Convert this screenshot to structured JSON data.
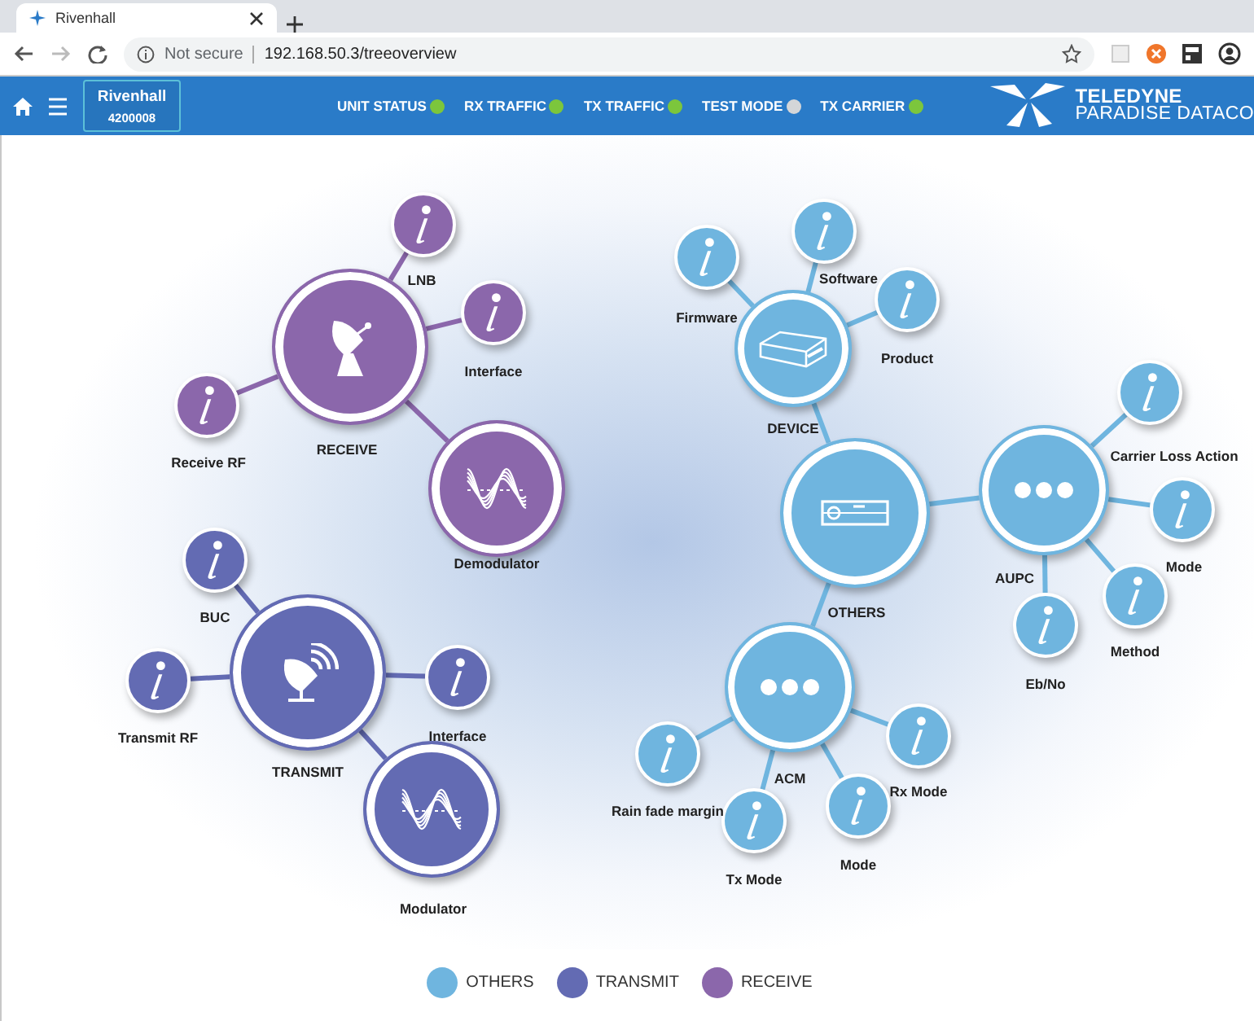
{
  "browser": {
    "tab_title": "Rivenhall",
    "security": "Not secure",
    "url": "192.168.50.3/treeoverview"
  },
  "header": {
    "device_name": "Rivenhall",
    "device_id": "4200008",
    "indicators": [
      {
        "label": "UNIT STATUS",
        "color": "#7cc63c"
      },
      {
        "label": "RX TRAFFIC",
        "color": "#7cc63c"
      },
      {
        "label": "TX TRAFFIC",
        "color": "#7cc63c"
      },
      {
        "label": "TEST MODE",
        "color": "#d4d6d8"
      },
      {
        "label": "TX CARRIER",
        "color": "#7cc63c"
      }
    ],
    "logo_lines": [
      "TELEDYNE",
      "PARADISE DATACO"
    ]
  },
  "diagram": {
    "groups": [
      {
        "label": "RECEIVE",
        "kind": "dish",
        "color": "#8b67ab",
        "children": [
          {
            "label": "LNB",
            "kind": "info"
          },
          {
            "label": "Interface",
            "kind": "info"
          },
          {
            "label": "Receive RF",
            "kind": "info"
          },
          {
            "label": "Demodulator",
            "kind": "wave"
          }
        ]
      },
      {
        "label": "TRANSMIT",
        "kind": "dish-signal",
        "color": "#636bb3",
        "children": [
          {
            "label": "BUC",
            "kind": "info"
          },
          {
            "label": "Transmit RF",
            "kind": "info"
          },
          {
            "label": "Interface",
            "kind": "info"
          },
          {
            "label": "Modulator",
            "kind": "wave"
          }
        ]
      },
      {
        "label": "OTHERS",
        "kind": "rack",
        "color": "#6fb5df",
        "children": [
          {
            "label": "DEVICE",
            "kind": "device",
            "children": [
              {
                "label": "Firmware",
                "kind": "info"
              },
              {
                "label": "Software",
                "kind": "info"
              },
              {
                "label": "Product",
                "kind": "info"
              }
            ]
          },
          {
            "label": "AUPC",
            "kind": "more",
            "children": [
              {
                "label": "Carrier Loss Action",
                "kind": "info"
              },
              {
                "label": "Mode",
                "kind": "info"
              },
              {
                "label": "Method",
                "kind": "info"
              },
              {
                "label": "Eb/No",
                "kind": "info"
              }
            ]
          },
          {
            "label": "ACM",
            "kind": "more",
            "children": [
              {
                "label": "Rain fade margin",
                "kind": "info"
              },
              {
                "label": "Tx Mode",
                "kind": "info"
              },
              {
                "label": "Mode",
                "kind": "info"
              },
              {
                "label": "Rx Mode",
                "kind": "info"
              }
            ]
          }
        ]
      }
    ]
  },
  "legend": [
    {
      "label": "OTHERS",
      "color": "#6fb5df"
    },
    {
      "label": "TRANSMIT",
      "color": "#636bb3"
    },
    {
      "label": "RECEIVE",
      "color": "#8b67ab"
    }
  ]
}
